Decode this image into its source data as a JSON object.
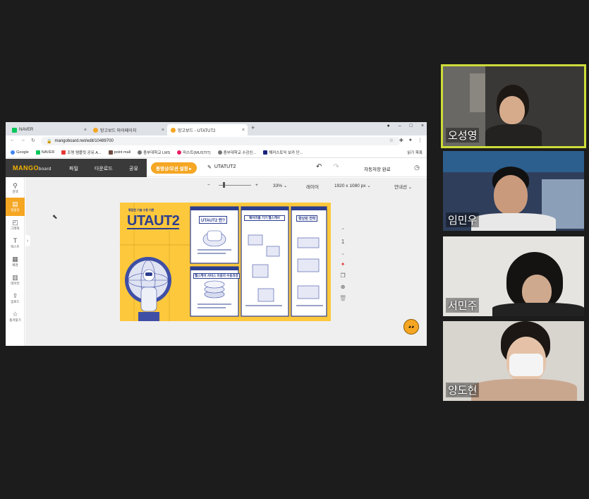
{
  "browser": {
    "tabs": [
      {
        "label": "NAVER",
        "favicon_color": "#03c75a"
      },
      {
        "label": "망고보드 마이페이지",
        "favicon_color": "#f5a623"
      },
      {
        "label": "망고보드 - UTATUT2",
        "favicon_color": "#f5a623"
      }
    ],
    "url": "mangoboard.net/edit/10489700",
    "bookmarks": [
      "Google",
      "NAVER",
      "조명 탬플릿 공유 A...",
      "point mall",
      "충부대학교 LMS",
      "마스트(MUSTIT)",
      "충부대학교 수강신...",
      "해커스토익 보카 단..."
    ],
    "bookmarks_more": "읽기 목록"
  },
  "editor": {
    "logo_main": "MANGO",
    "logo_sub": "board",
    "menu": [
      "파일",
      "다운로드",
      "공유"
    ],
    "video_button": "동영상/모션 설정 ▸",
    "doc_title": "UTATUT2",
    "autosave": "자동저장 완료",
    "zoom_minus": "−",
    "zoom_plus": "+",
    "zoom": "33%",
    "layer": "레이어",
    "size": "1920 x 1080 px",
    "guide": "안내선",
    "sidebar": [
      {
        "label": "검색",
        "icon": "search-icon"
      },
      {
        "label": "템플릿",
        "icon": "template-icon"
      },
      {
        "label": "그래픽",
        "icon": "graphic-icon"
      },
      {
        "label": "텍스트",
        "icon": "text-icon"
      },
      {
        "label": "배경",
        "icon": "background-icon"
      },
      {
        "label": "데이터",
        "icon": "chart-icon"
      },
      {
        "label": "업로드",
        "icon": "upload-icon"
      },
      {
        "label": "즐겨찾기",
        "icon": "star-icon"
      }
    ],
    "page_number": "1",
    "canvas": {
      "main_title": "UTAUT2",
      "header_note": "통합된 기술 수용 이론",
      "panel1_title": "UTAUT2 란?",
      "panel2_title": "헬스케어 서비스 이용의 수용과정",
      "panel3_title": "웨어러블 기기 헬스케어",
      "panel4_title": "향상된 전략"
    }
  },
  "participants": [
    {
      "name": "오성영",
      "active": true
    },
    {
      "name": "임민우",
      "active": false
    },
    {
      "name": "서민주",
      "active": false
    },
    {
      "name": "양도현",
      "active": false
    }
  ],
  "colors": {
    "accent_yellow": "#f5a623",
    "speaker_border": "#cddc39",
    "canvas_bg": "#fdc83c",
    "navy": "#2c3e8f"
  }
}
